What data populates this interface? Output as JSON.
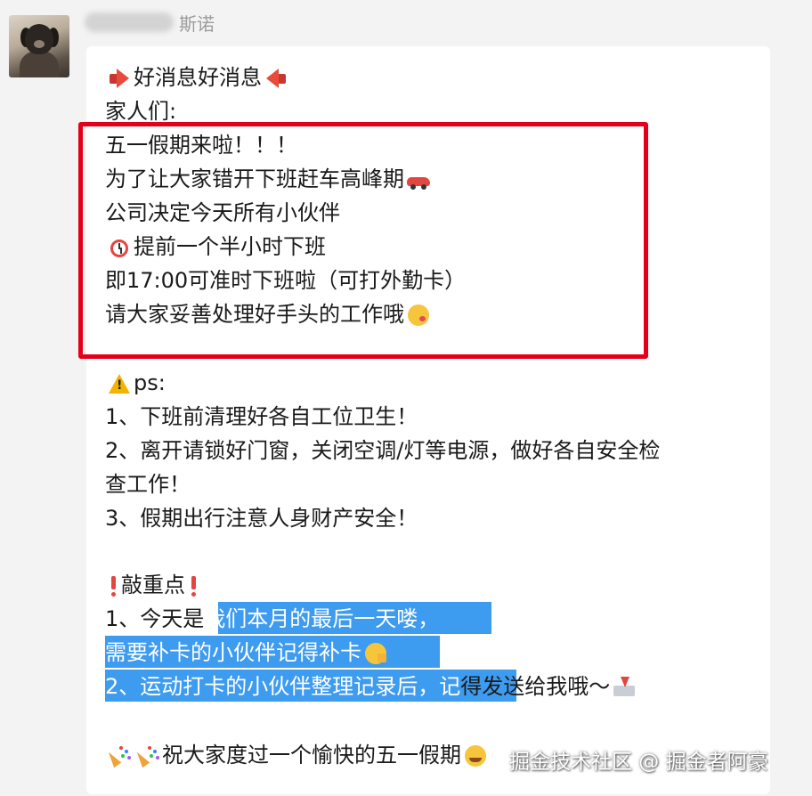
{
  "sender": {
    "name_visible": "斯诺"
  },
  "message": {
    "l1": "好消息好消息",
    "l2": "家人们:",
    "l3": "五一假期来啦！！！",
    "l4": "为了让大家错开下班赶车高峰期",
    "l5": "公司决定今天所有小伙伴",
    "l6": "提前一个半小时下班",
    "l7": "即17:00可准时下班啦（可打外勤卡）",
    "l8": "请大家妥善处理好手头的工作哦",
    "l9": "ps:",
    "l10": "1、下班前清理好各自工位卫生！",
    "l11": "2、离开请锁好门窗，关闭空调/灯等电源，做好各自安全检",
    "l12": "查工作！",
    "l13": "3、假期出行注意人身财产安全！",
    "l14": "敲重点",
    "l15a": "1、今天是",
    "l15b": "我们本月的最后一天喽，",
    "l16": "需要补卡的小伙伴记得补卡",
    "l17a": "2、运动打卡的小伙伴整理记录后，记",
    "l17b": "得发送给我哦～",
    "l18": "祝大家度过一个愉快的五一假期"
  },
  "watermark": "掘金技术社区 @ 掘金者阿豪",
  "icons": {
    "megaphone": "megaphone-icon",
    "car": "car-icon",
    "clock": "alarm-clock-icon",
    "kiss": "kiss-face-icon",
    "warning": "warning-icon",
    "exclamation": "exclamation-icon",
    "salute": "salute-face-icon",
    "inbox": "inbox-icon",
    "party": "party-popper-icon",
    "grin": "grin-face-icon"
  },
  "colors": {
    "highlight": "#3d9bf0",
    "frame": "#e4001a",
    "bubble": "#ffffff",
    "background": "#f3f3f3"
  }
}
